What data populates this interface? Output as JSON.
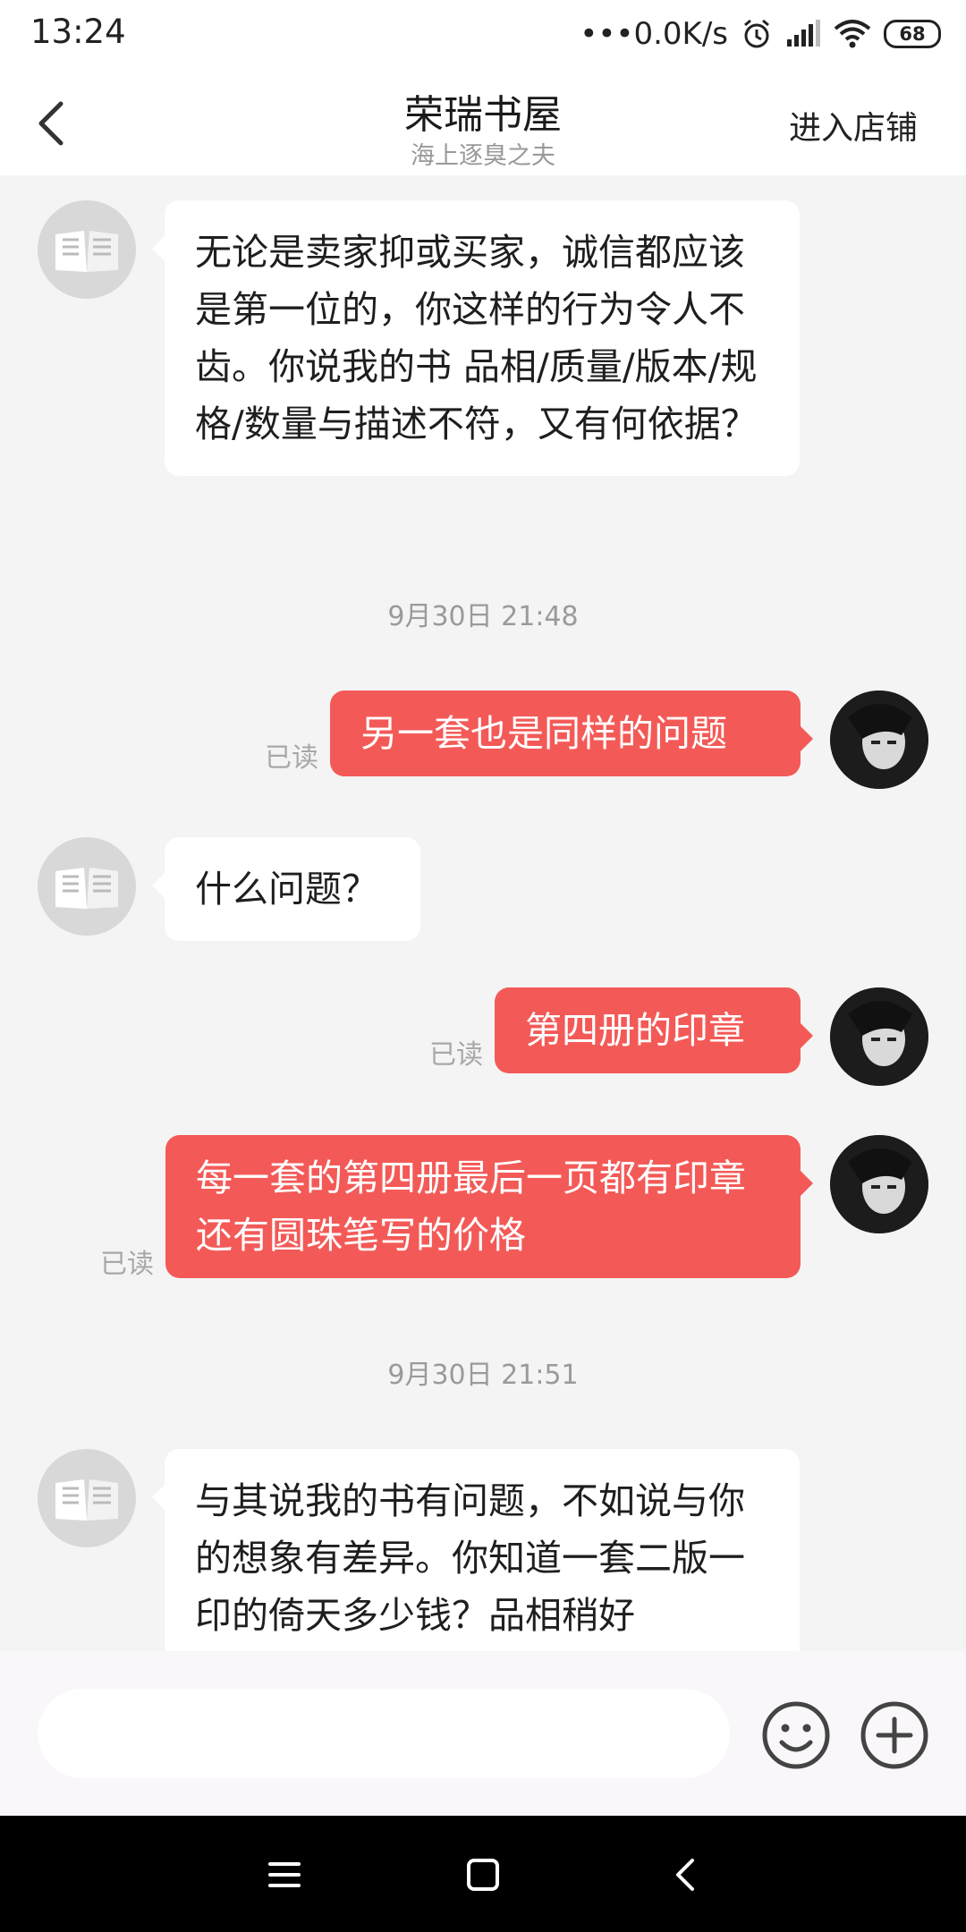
{
  "status_bar": {
    "time": "13:24",
    "network_speed": "•••0.0K/s",
    "battery": "68",
    "icons": [
      "alarm-icon",
      "signal-icon",
      "wifi-icon",
      "battery-icon"
    ]
  },
  "header": {
    "back_icon": "chevron-left-icon",
    "title": "荣瑞书屋",
    "subtitle": "海上逐臭之夫",
    "store_link": "进入店铺"
  },
  "colors": {
    "outgoing_bubble": "#f35a57",
    "incoming_bubble": "#ffffff",
    "background": "#f4f4f4"
  },
  "messages": [
    {
      "direction": "in",
      "text": "无论是卖家抑或买家，诚信都应该是第一位的，你这样的行为令人不齿。你说我的书 品相/质量/版本/规格/数量与描述不符，又有何依据？"
    },
    {
      "type": "timestamp",
      "text": "9月30日 21:48"
    },
    {
      "direction": "out",
      "text": "另一套也是同样的问题",
      "status": "已读"
    },
    {
      "direction": "in",
      "text": "什么问题？"
    },
    {
      "direction": "out",
      "text": "第四册的印章",
      "status": "已读"
    },
    {
      "direction": "out",
      "text": "每一套的第四册最后一页都有印章还有圆珠笔写的价格",
      "status": "已读"
    },
    {
      "type": "timestamp",
      "text": "9月30日 21:51"
    },
    {
      "direction": "in",
      "text": "与其说我的书有问题，不如说与你的想象有差异。你知道一套二版一印的倚天多少钱？品相稍好"
    }
  ],
  "input_bar": {
    "placeholder": "",
    "emoji_icon": "smiley-icon",
    "plus_icon": "plus-circle-icon"
  },
  "nav_bar": {
    "icons": [
      "menu-icon",
      "home-square-icon",
      "back-icon"
    ]
  }
}
